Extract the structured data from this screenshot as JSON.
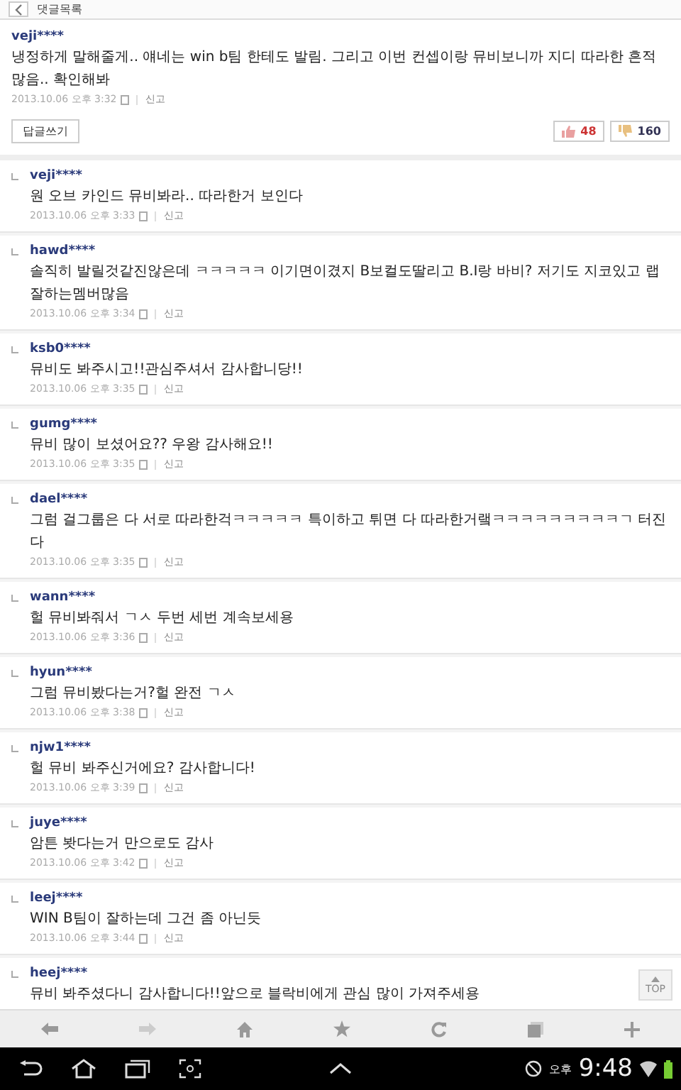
{
  "header": {
    "title": "댓글목록"
  },
  "comment": {
    "user": "veji****",
    "text": "냉정하게 말해줄게.. 얘네는 win b팀 한테도 발림. 그리고 이번 컨셉이랑 뮤비보니까 지디 따라한 흔적 많음.. 확인해봐",
    "time": "2013.10.06 오후 3:32",
    "report": "신고",
    "reply_button": "답글쓰기",
    "likes": "48",
    "dislikes": "160"
  },
  "replies": [
    {
      "user": "veji****",
      "text": "원 오브 카인드 뮤비봐라.. 따라한거 보인다",
      "time": "2013.10.06 오후 3:33",
      "report": "신고"
    },
    {
      "user": "hawd****",
      "text": "솔직히 발릴것같진않은데 ㅋㅋㅋㅋㅋ 이기면이겼지 B보컬도딸리고 B.I랑 바비? 저기도 지코있고 랩잘하는멤버많음",
      "time": "2013.10.06 오후 3:34",
      "report": "신고"
    },
    {
      "user": "ksb0****",
      "text": "뮤비도 봐주시고!!관심주셔서 감사합니당!!",
      "time": "2013.10.06 오후 3:35",
      "report": "신고"
    },
    {
      "user": "gumg****",
      "text": "뮤비 많이 보셨어요?? 우왕 감사해요!!",
      "time": "2013.10.06 오후 3:35",
      "report": "신고"
    },
    {
      "user": "dael****",
      "text": "그럼 걸그룹은 다 서로 따라한걱ㅋㅋㅋㅋㅋ 특이하고 튀면 다 따라한거랰ㅋㅋㅋㅋㅋㅋㅋㅋㅋㄱ 터진다",
      "time": "2013.10.06 오후 3:35",
      "report": "신고"
    },
    {
      "user": "wann****",
      "text": "헐 뮤비봐줘서 ㄱㅅ 두번 세번 계속보세용",
      "time": "2013.10.06 오후 3:36",
      "report": "신고"
    },
    {
      "user": "hyun****",
      "text": "그럼 뮤비봤다는거?헐 완전 ㄱㅅ",
      "time": "2013.10.06 오후 3:38",
      "report": "신고"
    },
    {
      "user": "njw1****",
      "text": "헐 뮤비 봐주신거에요? 감사합니다!",
      "time": "2013.10.06 오후 3:39",
      "report": "신고"
    },
    {
      "user": "juye****",
      "text": "암튼 봣다는거 만으로도 감사",
      "time": "2013.10.06 오후 3:42",
      "report": "신고"
    },
    {
      "user": "leej****",
      "text": "WIN B팀이 잘하는데 그건 좀 아닌듯",
      "time": "2013.10.06 오후 3:44",
      "report": "신고"
    },
    {
      "user": "heej****",
      "text": "뮤비 봐주셨다니 감사합니다!!앞으로 블락비에게 관심 많이 가져주세용"
    }
  ],
  "top_button": "TOP",
  "status_bar": {
    "ampm": "오후",
    "time": "9:48"
  }
}
